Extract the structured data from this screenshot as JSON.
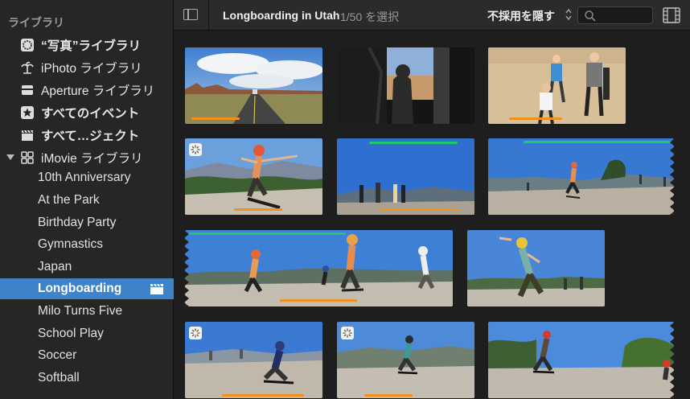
{
  "sidebar": {
    "header": "ライブラリ",
    "libraries": [
      {
        "label": "“写真”ライブラリ",
        "icon": "photos-flower-icon"
      },
      {
        "label": "iPhoto ライブラリ",
        "icon": "palm-tree-icon"
      },
      {
        "label": "Aperture ライブラリ",
        "icon": "aperture-box-icon"
      },
      {
        "label": "すべてのイベント",
        "icon": "star-icon"
      },
      {
        "label": "すべて…ジェクト",
        "icon": "clapperboard-icon"
      },
      {
        "label": "iMovie ライブラリ",
        "icon": "grid-library-icon"
      }
    ],
    "events": [
      {
        "label": "10th Anniversary"
      },
      {
        "label": "At the Park"
      },
      {
        "label": "Birthday Party"
      },
      {
        "label": "Gymnastics"
      },
      {
        "label": "Japan"
      },
      {
        "label": "Longboarding",
        "selected": true
      },
      {
        "label": "Milo Turns Five"
      },
      {
        "label": "School Play"
      },
      {
        "label": "Soccer"
      },
      {
        "label": "Softball"
      }
    ]
  },
  "toolbar": {
    "title": "Longboarding in Utah",
    "selection": "1/50 を選択",
    "hide_rejected": "不採用を隠す",
    "search_placeholder": ""
  },
  "colors": {
    "selection_blue": "#3e82c8",
    "favorite_green": "#1fc86a",
    "keyword_orange": "#f0901e"
  },
  "clips": [
    {
      "name": "clip-road-valley"
    },
    {
      "name": "clip-van-door"
    },
    {
      "name": "clip-desert-people"
    },
    {
      "name": "clip-skater-lean"
    },
    {
      "name": "clip-group-standing"
    },
    {
      "name": "clip-riders-distance"
    },
    {
      "name": "clip-skaters-road"
    },
    {
      "name": "clip-yellow-helmet"
    },
    {
      "name": "clip-crouch-rider"
    },
    {
      "name": "clip-teal-rider"
    },
    {
      "name": "clip-red-helmet-rider"
    }
  ]
}
